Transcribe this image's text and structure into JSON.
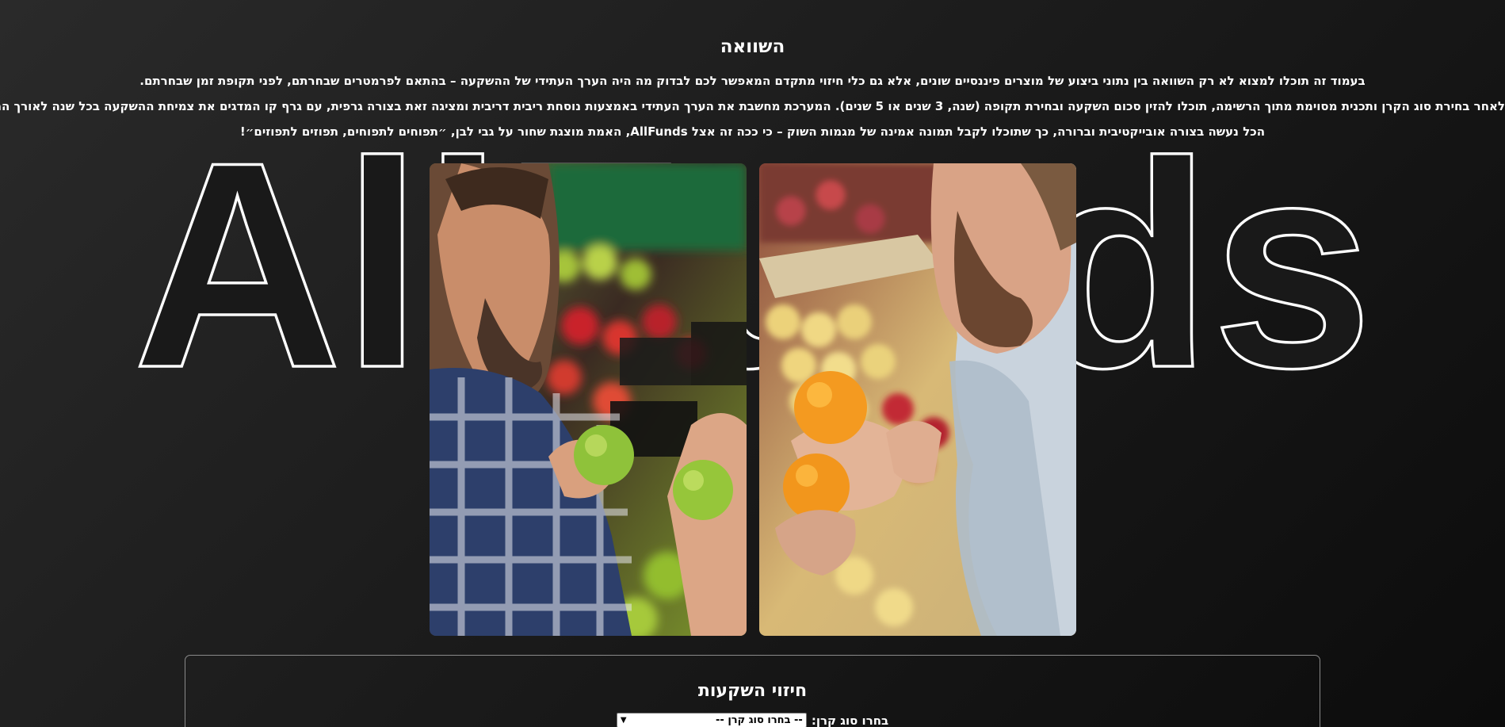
{
  "background_logo": {
    "text": "AllFunds"
  },
  "header": {
    "title": "השוואה",
    "paragraphs": [
      "בעמוד זה תוכלו למצוא לא רק השוואה בין נתוני ביצוע של מוצרים פיננסיים שונים, אלא גם כלי חיזוי מתקדם המאפשר לכם לבדוק מה היה הערך העתידי של ההשקעה – בהתאם לפרמטרים שבחרתם, לפני תקופת זמן שבחרתם.",
      "לאחר בחירת סוג הקרן ותכנית מסוימת מתוך הרשימה, תוכלו להזין סכום השקעה ובחירת תקופה (שנה, 3 שנים או 5 שנים). המערכת מחשבת את הערך העתידי באמצעות נוסחת ריבית דריבית ומציגה זאת בצורה גרפית, עם גרף קו המדגים את צמיחת ההשקעה בכל שנה לאורך התקופה.",
      "הכל נעשה בצורה אובייקטיבית וברורה, כך שתוכלו לקבל תמונה אמינה של מגמות השוק – כי ככה זה אצל AllFunds, האמת מוצגת שחור על גבי לבן, ״תפוחים לתפוחים, תפוזים לתפוזים״!"
    ]
  },
  "photos": [
    {
      "subject": "man-holding-green-apples"
    },
    {
      "subject": "man-holding-oranges"
    }
  ],
  "forecast": {
    "title": "חיזוי השקעות",
    "fund_type_label": "בחרו סוג קרן:",
    "fund_type_value": "-- בחרו סוג קרן --"
  },
  "colors": {
    "background_light": "#2a2a2a",
    "background_dark": "#0c0c0c",
    "text": "#ffffff",
    "card_border": "#8a8a8a"
  }
}
